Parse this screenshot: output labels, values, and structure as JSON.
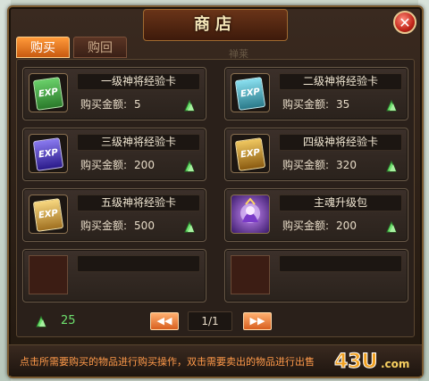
{
  "window": {
    "title": "商店"
  },
  "tabs": {
    "buy": "购买",
    "sell": "购回"
  },
  "watermark": "禅莱",
  "price_label": "购买金额:",
  "items": [
    {
      "name": "一级神将经验卡",
      "price": "5",
      "icon": "exp-card-green-icon",
      "color": "#3aa04a"
    },
    {
      "name": "二级神将经验卡",
      "price": "35",
      "icon": "exp-card-cyan-icon",
      "color": "#3aa8b8"
    },
    {
      "name": "三级神将经验卡",
      "price": "200",
      "icon": "exp-card-purple-icon",
      "color": "#5a4ab8"
    },
    {
      "name": "四级神将经验卡",
      "price": "320",
      "icon": "exp-card-gold-icon",
      "color": "#c08a20"
    },
    {
      "name": "五级神将经验卡",
      "price": "500",
      "icon": "exp-card-gold-icon",
      "color": "#c8a030"
    },
    {
      "name": "主魂升级包",
      "price": "200",
      "icon": "soul-package-icon",
      "color": "#9a5ae0"
    }
  ],
  "currency": {
    "amount": "25",
    "icon": "jade-gem-icon"
  },
  "pager": {
    "page": "1/1",
    "prev": "◀◀",
    "next": "▶▶"
  },
  "hint": "点击所需要购买的物品进行购买操作，双击需要卖出的物品进行出售",
  "logo": "43U.com",
  "colors": {
    "accent": "#ff9a3a",
    "gem": "#6ee06e",
    "hint": "#ff9a4a"
  }
}
